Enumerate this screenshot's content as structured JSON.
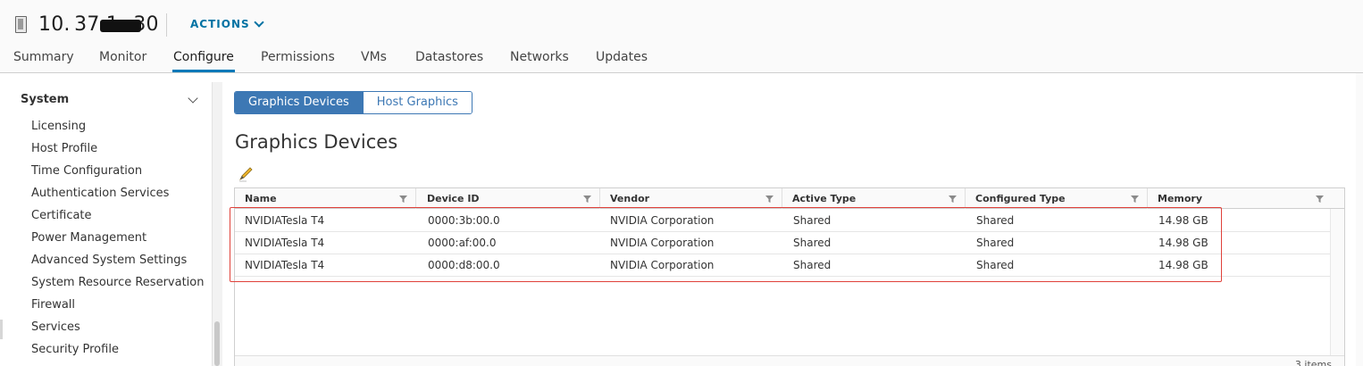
{
  "header": {
    "host_name": "10. 37.1  .30",
    "actions_label": "ACTIONS"
  },
  "tabs": [
    {
      "label": "Summary"
    },
    {
      "label": "Monitor"
    },
    {
      "label": "Configure",
      "active": true
    },
    {
      "label": "Permissions"
    },
    {
      "label": "VMs"
    },
    {
      "label": "Datastores"
    },
    {
      "label": "Networks"
    },
    {
      "label": "Updates"
    }
  ],
  "sidebar": {
    "section_title": "System",
    "items": [
      {
        "label": "Licensing"
      },
      {
        "label": "Host Profile"
      },
      {
        "label": "Time Configuration"
      },
      {
        "label": "Authentication Services"
      },
      {
        "label": "Certificate"
      },
      {
        "label": "Power Management"
      },
      {
        "label": "Advanced System Settings"
      },
      {
        "label": "System Resource Reservation"
      },
      {
        "label": "Firewall"
      },
      {
        "label": "Services"
      },
      {
        "label": "Security Profile"
      }
    ]
  },
  "main": {
    "segments": [
      {
        "label": "Graphics Devices",
        "selected": true
      },
      {
        "label": "Host Graphics",
        "selected": false
      }
    ],
    "page_title": "Graphics Devices",
    "edit_icon": "pencil-icon",
    "table": {
      "columns": [
        "Name",
        "Device ID",
        "Vendor",
        "Active Type",
        "Configured Type",
        "Memory"
      ],
      "rows": [
        [
          "NVIDIATesla T4",
          "0000:3b:00.0",
          "NVIDIA Corporation",
          "Shared",
          "Shared",
          "14.98 GB"
        ],
        [
          "NVIDIATesla T4",
          "0000:af:00.0",
          "NVIDIA Corporation",
          "Shared",
          "Shared",
          "14.98 GB"
        ],
        [
          "NVIDIATesla T4",
          "0000:d8:00.0",
          "NVIDIA Corporation",
          "Shared",
          "Shared",
          "14.98 GB"
        ]
      ],
      "footer_count": "3 items"
    }
  },
  "colors": {
    "accent": "#3d78b4",
    "tab_underline": "#0079b8",
    "link": "#0072a3",
    "highlight_box": "#e0413a"
  }
}
